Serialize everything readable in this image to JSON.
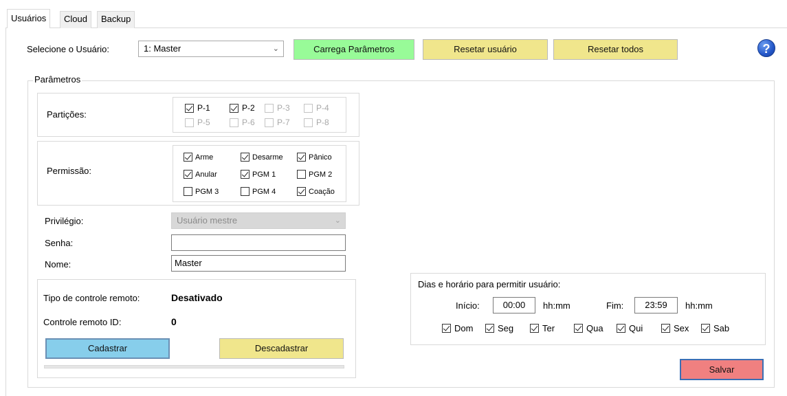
{
  "tabs": [
    {
      "label": "Usuários",
      "active": true
    },
    {
      "label": "Cloud",
      "active": false
    },
    {
      "label": "Backup",
      "active": false
    }
  ],
  "top": {
    "select_user_label": "Selecione o Usuário:",
    "select_user_value": "1: Master",
    "load_params_button": "Carrega Parâmetros",
    "reset_user_button": "Resetar usuário",
    "reset_all_button": "Resetar todos",
    "help_glyph": "?"
  },
  "params": {
    "legend": "Parâmetros",
    "partitions_label": "Partições:",
    "partitions": [
      {
        "label": "P-1",
        "checked": true,
        "enabled": true
      },
      {
        "label": "P-2",
        "checked": true,
        "enabled": true
      },
      {
        "label": "P-3",
        "checked": false,
        "enabled": false
      },
      {
        "label": "P-4",
        "checked": false,
        "enabled": false
      },
      {
        "label": "P-5",
        "checked": false,
        "enabled": false
      },
      {
        "label": "P-6",
        "checked": false,
        "enabled": false
      },
      {
        "label": "P-7",
        "checked": false,
        "enabled": false
      },
      {
        "label": "P-8",
        "checked": false,
        "enabled": false
      }
    ],
    "permission_label": "Permissão:",
    "permissions": [
      {
        "label": "Arme",
        "checked": true
      },
      {
        "label": "Desarme",
        "checked": true
      },
      {
        "label": "Pânico",
        "checked": true
      },
      {
        "label": "Anular",
        "checked": true
      },
      {
        "label": "PGM 1",
        "checked": true
      },
      {
        "label": "PGM 2",
        "checked": false
      },
      {
        "label": "PGM 3",
        "checked": false
      },
      {
        "label": "PGM 4",
        "checked": false
      },
      {
        "label": "Coação",
        "checked": true
      }
    ],
    "privilege_label": "Privilégio:",
    "privilege_value": "Usuário mestre",
    "password_label": "Senha:",
    "password_value": "",
    "name_label": "Nome:",
    "name_value": "Master"
  },
  "remote": {
    "type_label": "Tipo de controle remoto:",
    "type_value": "Desativado",
    "id_label": "Controle remoto ID:",
    "id_value": "0",
    "register_button": "Cadastrar",
    "unregister_button": "Descadastrar"
  },
  "schedule": {
    "title": "Dias e horário para permitir usuário:",
    "start_label": "Início:",
    "start_value": "00:00",
    "start_unit": "hh:mm",
    "end_label": "Fim:",
    "end_value": "23:59",
    "end_unit": "hh:mm",
    "days": [
      {
        "label": "Dom",
        "checked": true
      },
      {
        "label": "Seg",
        "checked": true
      },
      {
        "label": "Ter",
        "checked": true
      },
      {
        "label": "Qua",
        "checked": true
      },
      {
        "label": "Qui",
        "checked": true
      },
      {
        "label": "Sex",
        "checked": true
      },
      {
        "label": "Sab",
        "checked": true
      }
    ]
  },
  "save_button": "Salvar",
  "colors": {
    "load_button_bg": "#98fb98",
    "reset_button_bg": "#f0e68c",
    "register_button_bg": "#87ceeb",
    "save_button_bg": "#f08080"
  }
}
